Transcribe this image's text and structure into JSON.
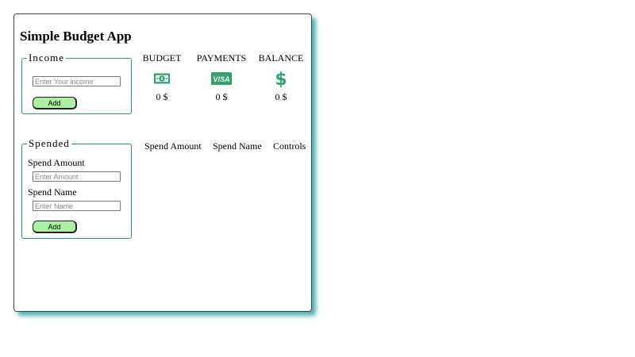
{
  "app": {
    "title": "Simple Budget App"
  },
  "income": {
    "legend": "Income",
    "input_placeholder": "Enter Your income",
    "add_label": "Add"
  },
  "stats": {
    "budget": {
      "label": "BUDGET",
      "value": "0 $",
      "icon": "money-bill-icon"
    },
    "payments": {
      "label": "PAYMENTS",
      "value": "0 $",
      "icon": "visa-card-icon"
    },
    "balance": {
      "label": "BALANCE",
      "value": "0 $",
      "icon": "dollar-sign-icon"
    }
  },
  "spend": {
    "legend": "Spended",
    "amount_label": "Spend Amount",
    "amount_placeholder": "Enter Amount",
    "name_label": "Spend Name",
    "name_placeholder": "Enter Name",
    "add_label": "Add"
  },
  "table": {
    "columns": [
      "Spend Amount",
      "Spend Name",
      "Controls"
    ]
  },
  "colors": {
    "accent": "#2fa36b",
    "button_bg": "#abf0a3",
    "border": "#2c8f88",
    "shadow": "#0f9696"
  }
}
